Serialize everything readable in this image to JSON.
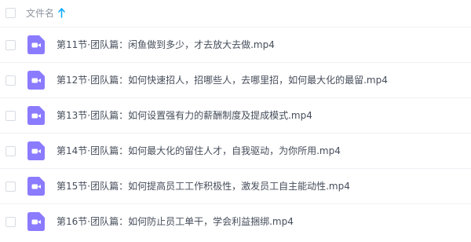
{
  "header": {
    "column_label": "文件名",
    "sort_icon": "arrow-up-icon",
    "sort_color": "#06a7ff"
  },
  "colors": {
    "video_icon": "#8b7bff",
    "text": "#454d5a",
    "header_text": "#8e959f"
  },
  "files": [
    {
      "name": "第11节·团队篇：闲鱼做到多少，才去放大去做.mp4",
      "icon": "video-file-icon"
    },
    {
      "name": "第12节·团队篇：如何快速招人，招哪些人，去哪里招，如何最大化的最留.mp4",
      "icon": "video-file-icon"
    },
    {
      "name": "第13节·团队篇：如何设置强有力的薪酬制度及提成模式.mp4",
      "icon": "video-file-icon"
    },
    {
      "name": "第14节·团队篇：如何最大化的留住人才，自我驱动，为你所用.mp4",
      "icon": "video-file-icon"
    },
    {
      "name": "第15节·团队篇：如何提高员工工作积极性，激发员工自主能动性.mp4",
      "icon": "video-file-icon"
    },
    {
      "name": "第16节·团队篇：如何防止员工单干，学会利益捆绑.mp4",
      "icon": "video-file-icon"
    }
  ]
}
